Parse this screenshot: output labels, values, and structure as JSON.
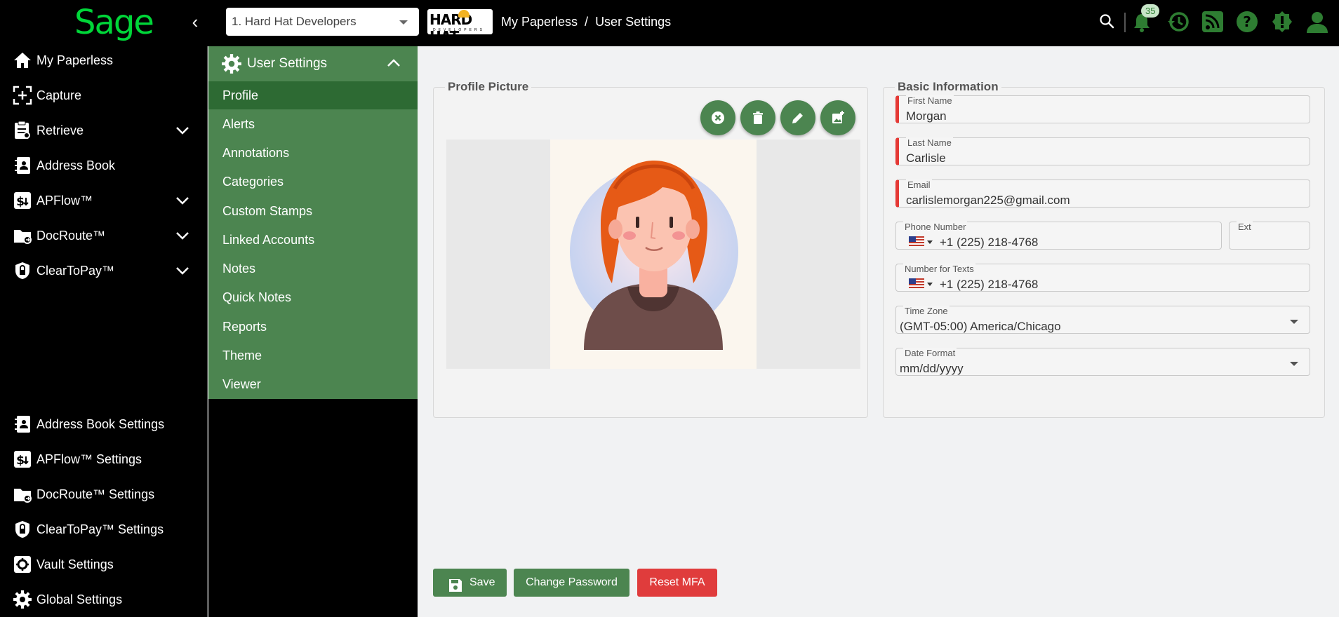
{
  "app": {
    "logo_text": "Sage",
    "brand_color": "#00d639",
    "accent_color": "#4c8550"
  },
  "header": {
    "company_select": "1. Hard Hat Developers",
    "company_logo_text": "HARD HAT",
    "company_logo_sub": "DEVELOPERS",
    "breadcrumb": [
      "My Paperless",
      "User Settings"
    ],
    "breadcrumb_sep": "/",
    "notifications_count": "35",
    "icons": [
      "search-icon",
      "bell-icon",
      "history-icon",
      "rss-icon",
      "help-icon",
      "alert-icon",
      "user-icon"
    ]
  },
  "sidebar": {
    "items": [
      {
        "label": "My Paperless",
        "icon": "home-icon"
      },
      {
        "label": "Capture",
        "icon": "capture-icon"
      },
      {
        "label": "Retrieve",
        "icon": "retrieve-icon",
        "expandable": true
      },
      {
        "label": "Address Book",
        "icon": "address-book-icon"
      },
      {
        "label": "APFlow™",
        "icon": "apflow-icon",
        "expandable": true
      },
      {
        "label": "DocRoute™",
        "icon": "docroute-icon",
        "expandable": true
      },
      {
        "label": "ClearToPay™",
        "icon": "cleartopay-icon",
        "expandable": true
      }
    ],
    "settings": [
      {
        "label": "Address Book Settings",
        "icon": "address-book-icon"
      },
      {
        "label": "APFlow™ Settings",
        "icon": "apflow-icon"
      },
      {
        "label": "DocRoute™ Settings",
        "icon": "docroute-icon"
      },
      {
        "label": "ClearToPay™ Settings",
        "icon": "cleartopay-icon"
      },
      {
        "label": "Vault Settings",
        "icon": "vault-gear-icon"
      },
      {
        "label": "Global Settings",
        "icon": "gear-icon"
      }
    ]
  },
  "subnav": {
    "title": "User Settings",
    "items": [
      "Profile",
      "Alerts",
      "Annotations",
      "Categories",
      "Custom Stamps",
      "Linked Accounts",
      "Notes",
      "Quick Notes",
      "Reports",
      "Theme",
      "Viewer"
    ],
    "active": "Profile"
  },
  "profile_picture": {
    "legend": "Profile Picture",
    "actions": [
      "cancel-icon",
      "delete-icon",
      "edit-icon",
      "add-photo-icon"
    ]
  },
  "basic_info": {
    "legend": "Basic Information",
    "first_name": {
      "label": "First Name",
      "value": "Morgan"
    },
    "last_name": {
      "label": "Last Name",
      "value": "Carlisle"
    },
    "email": {
      "label": "Email",
      "value": "carlislemorgan225@gmail.com"
    },
    "phone": {
      "label": "Phone Number",
      "value": "+1 (225) 218-4768"
    },
    "ext": {
      "label": "Ext",
      "value": ""
    },
    "texts": {
      "label": "Number for Texts",
      "value": "+1 (225) 218-4768"
    },
    "timezone": {
      "label": "Time Zone",
      "value": "(GMT-05:00) America/Chicago"
    },
    "date_format": {
      "label": "Date Format",
      "value": "mm/dd/yyyy"
    }
  },
  "actions": {
    "save": "Save",
    "change_password": "Change Password",
    "reset_mfa": "Reset MFA"
  }
}
